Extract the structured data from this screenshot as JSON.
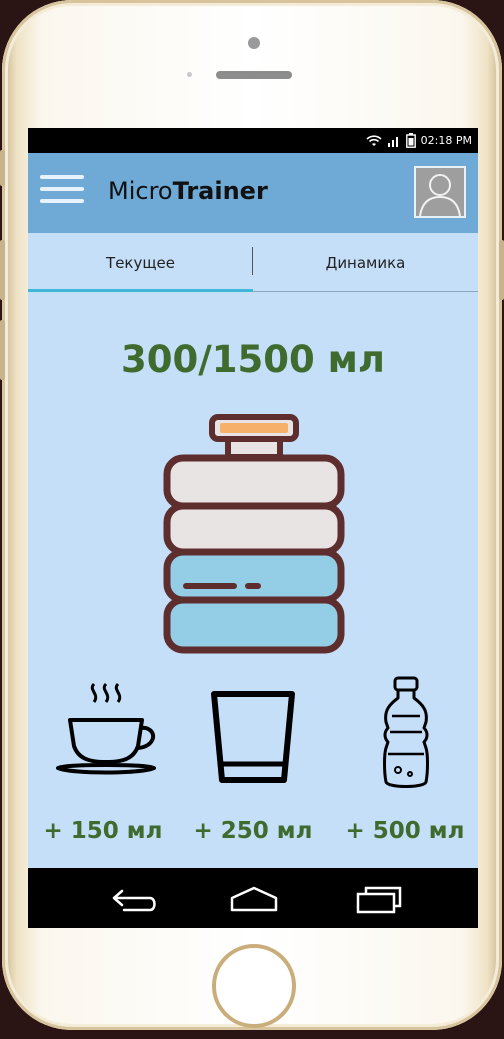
{
  "status": {
    "time": "02:18 PM"
  },
  "header": {
    "title_light": "Micro",
    "title_bold": "Trainer"
  },
  "tabs": [
    {
      "label": "Текущее",
      "active": true
    },
    {
      "label": "Динамика",
      "active": false
    }
  ],
  "water": {
    "consumed": 300,
    "goal": 1500,
    "text": "300/1500 мл"
  },
  "drinks": [
    {
      "icon": "coffee-cup-icon",
      "label": "+ 150 мл"
    },
    {
      "icon": "glass-icon",
      "label": "+ 250 мл"
    },
    {
      "icon": "water-bottle-icon",
      "label": "+ 500 мл"
    }
  ],
  "navbar": [
    "back-icon",
    "home-icon",
    "recent-apps-icon"
  ]
}
